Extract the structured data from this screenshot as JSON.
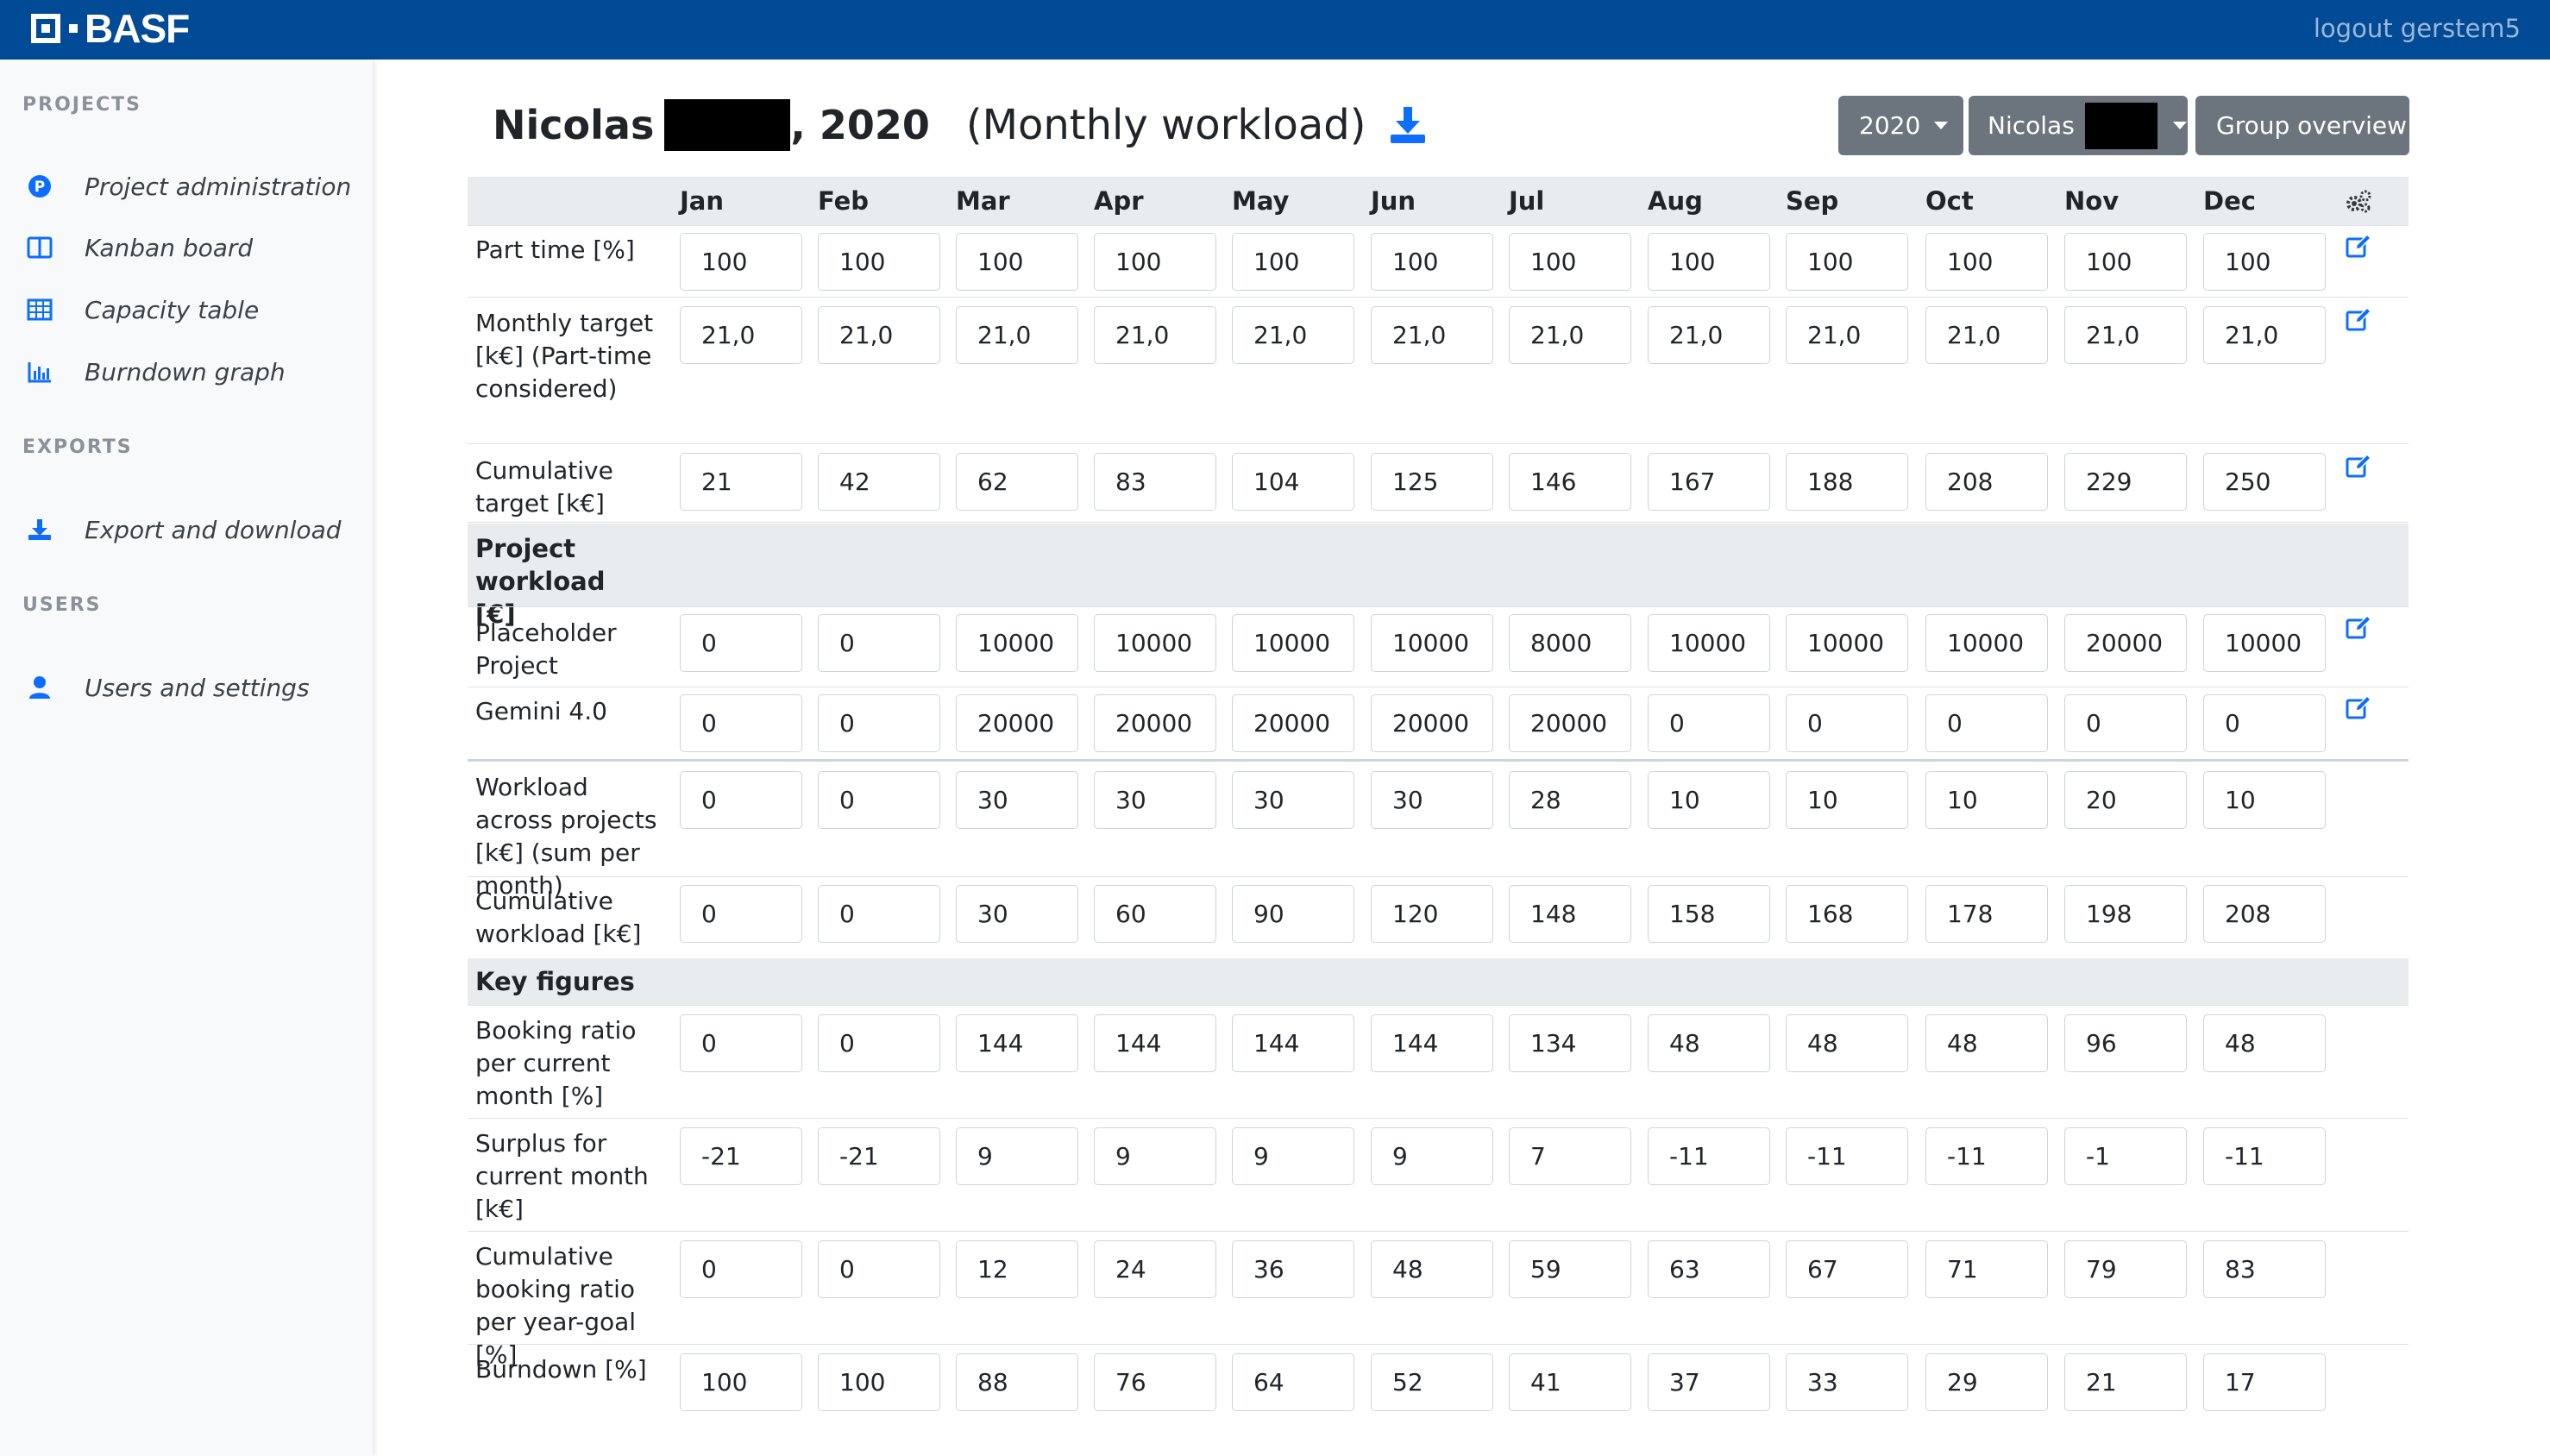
{
  "header": {
    "brand": "BASF",
    "logout": "logout gerstem5"
  },
  "sidebar": {
    "sections": [
      {
        "heading": "PROJECTS",
        "items": [
          {
            "label": "Project administration",
            "icon": "project-p-icon"
          },
          {
            "label": "Kanban board",
            "icon": "kanban-icon"
          },
          {
            "label": "Capacity table",
            "icon": "table-icon"
          },
          {
            "label": "Burndown graph",
            "icon": "bar-chart-icon"
          }
        ]
      },
      {
        "heading": "EXPORTS",
        "items": [
          {
            "label": "Export and download",
            "icon": "download-icon"
          }
        ]
      },
      {
        "heading": "USERS",
        "items": [
          {
            "label": "Users and settings",
            "icon": "user-icon"
          }
        ]
      }
    ]
  },
  "page": {
    "title_name": "Nicolas",
    "title_year": ", 2020",
    "title_subtitle": "(Monthly workload)",
    "year_select": "2020",
    "user_select": "Nicolas",
    "group_overview": "Group overview"
  },
  "colors": {
    "brand": "#004a96",
    "button": "#6c757d",
    "accent": "#0d6efd"
  },
  "months": [
    "Jan",
    "Feb",
    "Mar",
    "Apr",
    "May",
    "Jun",
    "Jul",
    "Aug",
    "Sep",
    "Oct",
    "Nov",
    "Dec"
  ],
  "rows": {
    "part_time": {
      "label": "Part time [%]",
      "values": [
        "100",
        "100",
        "100",
        "100",
        "100",
        "100",
        "100",
        "100",
        "100",
        "100",
        "100",
        "100"
      ]
    },
    "monthly_target": {
      "label": "Monthly target [k€] (Part-time considered)",
      "values": [
        "21,0",
        "21,0",
        "21,0",
        "21,0",
        "21,0",
        "21,0",
        "21,0",
        "21,0",
        "21,0",
        "21,0",
        "21,0",
        "21,0"
      ]
    },
    "cumulative_target": {
      "label": "Cumulative target [k€]",
      "values": [
        "21",
        "42",
        "62",
        "83",
        "104",
        "125",
        "146",
        "167",
        "188",
        "208",
        "229",
        "250"
      ]
    },
    "project_workload_heading": "Project workload [€]",
    "placeholder_project": {
      "label": "Placeholder Project",
      "values": [
        "0",
        "0",
        "10000",
        "10000",
        "10000",
        "10000",
        "8000",
        "10000",
        "10000",
        "10000",
        "20000",
        "10000"
      ]
    },
    "gemini": {
      "label": "Gemini 4.0",
      "values": [
        "0",
        "0",
        "20000",
        "20000",
        "20000",
        "20000",
        "20000",
        "0",
        "0",
        "0",
        "0",
        "0"
      ]
    },
    "workload_across": {
      "label": "Workload across projects [k€] (sum per month)",
      "values": [
        "0",
        "0",
        "30",
        "30",
        "30",
        "30",
        "28",
        "10",
        "10",
        "10",
        "20",
        "10"
      ]
    },
    "cumulative_workload": {
      "label": "Cumulative workload [k€]",
      "values": [
        "0",
        "0",
        "30",
        "60",
        "90",
        "120",
        "148",
        "158",
        "168",
        "178",
        "198",
        "208"
      ]
    },
    "key_figures_heading": "Key figures",
    "booking_ratio": {
      "label": "Booking ratio per current month [%]",
      "values": [
        "0",
        "0",
        "144",
        "144",
        "144",
        "144",
        "134",
        "48",
        "48",
        "48",
        "96",
        "48"
      ]
    },
    "surplus": {
      "label": "Surplus for current month [k€]",
      "values": [
        "-21",
        "-21",
        "9",
        "9",
        "9",
        "9",
        "7",
        "-11",
        "-11",
        "-11",
        "-1",
        "-11"
      ]
    },
    "cumulative_booking": {
      "label": "Cumulative booking ratio per year-goal [%]",
      "values": [
        "0",
        "0",
        "12",
        "24",
        "36",
        "48",
        "59",
        "63",
        "67",
        "71",
        "79",
        "83"
      ]
    },
    "burndown": {
      "label": "Burndown [%]",
      "values": [
        "100",
        "100",
        "88",
        "76",
        "64",
        "52",
        "41",
        "37",
        "33",
        "29",
        "21",
        "17"
      ]
    }
  }
}
